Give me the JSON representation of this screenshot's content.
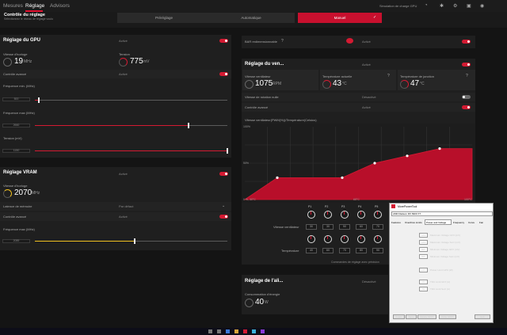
{
  "nav": {
    "tabs": [
      "Mesures",
      "Réglage",
      "Advisors"
    ],
    "active": "Réglage",
    "right_label": "Simulation de charge GPU"
  },
  "header": {
    "title": "Contrôle du réglage",
    "subtitle": "Sélectionnez le niveau de réglage voulu",
    "presets": [
      "Préréglage",
      "Automatique",
      "Manuel"
    ],
    "active_preset": "Manuel",
    "check": "✓"
  },
  "gpu": {
    "title": "Réglage du GPU",
    "status": "Activé",
    "clock_label": "Vitesse d'horloge",
    "clock_value": "19",
    "clock_unit": "MHz",
    "volt_label": "Tension",
    "volt_value": "775",
    "volt_unit": "mV",
    "advanced_label": "Contrôle avancé",
    "advanced_status": "Activé",
    "fmin_label": "Fréquence min. (MHz)",
    "fmin_value": "500",
    "fmin_fraction": 0.02,
    "fmax_label": "Fréquence max (MHz)",
    "fmax_value": "2660",
    "fmax_fraction": 0.8,
    "tension_label": "Tension (mV)",
    "tension_value": "1150",
    "tension_fraction": 1.0
  },
  "vram": {
    "title": "Réglage VRAM",
    "status": "Activé",
    "clock_label": "Vitesse d'horloge",
    "clock_value": "2070",
    "clock_unit": "MHz",
    "latency_label": "Latence de mémoire",
    "latency_value": "Par défaut",
    "advanced_label": "Contrôle avancé",
    "advanced_status": "Activé",
    "fmax_label": "Fréquence max (MHz)",
    "fmax_value": "2089",
    "fmax_fraction": 0.52
  },
  "bar": {
    "label": "BAR redimensionnable",
    "status": "Activé",
    "info": "?"
  },
  "fan": {
    "title": "Réglage du ven...",
    "status": "Activé",
    "speed_label": "Vitesse ventilateur",
    "speed_value": "1075",
    "speed_unit": "RPM",
    "temp_label": "Température actuelle",
    "temp_value": "43",
    "temp_unit": "°C",
    "junction_label": "Température de jonction",
    "junction_value": "47",
    "junction_unit": "°C",
    "info": "?",
    "zero_rpm_label": "Vitesse de rotation nulle",
    "zero_rpm_status": "Désactivé",
    "advanced_label": "Contrôle avancé",
    "advanced_status": "Activé",
    "curve_label": "Vitesse ventilateur(PWM(%))/Température(Celsius)",
    "y_top": "100%",
    "y_mid": "50%",
    "x_start": "0 %, 30°C",
    "x_mid": "65°C",
    "x_end": "100°C",
    "points_header": [
      "P1",
      "P2",
      "P3",
      "P4",
      "P5"
    ],
    "fan_row_label": "Vitesse ventilateur",
    "fan_values": [
      "30",
      "30",
      "50",
      "60",
      "70"
    ],
    "temp_row_label": "Température",
    "temp_values": [
      "40",
      "60",
      "70",
      "80",
      "90"
    ],
    "footnote": "Commandes de réglage avec précision"
  },
  "chart_data": {
    "type": "area",
    "x": [
      30,
      40,
      60,
      70,
      80,
      90,
      100
    ],
    "y": [
      0,
      30,
      30,
      50,
      60,
      70,
      70
    ],
    "xlim": [
      30,
      100
    ],
    "ylim": [
      0,
      100
    ]
  },
  "power": {
    "title": "Réglage de l'ali...",
    "status": "Désactivé",
    "consumption_label": "Consommation d'énergie",
    "consumption_value": "40",
    "consumption_unit": "W"
  },
  "mpt": {
    "title": "MorePowerTool",
    "gpu_select": "AMD Radeon RX 6900 XT",
    "tabs": [
      "Features",
      "Overdrive Limits",
      "Power and Voltage",
      "Frequency",
      "Curve",
      "Fan"
    ],
    "rows": [
      {
        "value": "1200",
        "label": "Maximum Voltage GFX (mV)"
      },
      {
        "value": "1200",
        "label": "Maximum Voltage SoC (mV)"
      },
      {
        "value": "825",
        "label": "Minimum Voltage GFX (mV)"
      },
      {
        "value": "825",
        "label": "Minimum Voltage SoC (mV)"
      },
      {
        "value": "225",
        "label": "Power Limit GPU (W)"
      },
      {
        "value": "340",
        "label": "TDC Limit GFX (A)"
      },
      {
        "value": "55",
        "label": "TDC Limit SoC (A)"
      }
    ],
    "buttons": [
      "Load",
      "Save",
      "Delete SPPT",
      "Write SPPT",
      "Exit"
    ]
  }
}
